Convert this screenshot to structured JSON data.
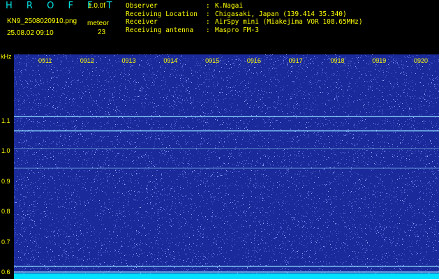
{
  "header": {
    "app_title": "H R O F F T",
    "version": "1.0.0f",
    "file_name": "KN9_2508020910.png",
    "file_datetime": "25.08.02 09:10",
    "meteor_label": "meteor",
    "meteor_count": "23",
    "info": [
      {
        "key": "Observer",
        "sep": ":",
        "value": "K.Nagai"
      },
      {
        "key": "Receiving Location",
        "sep": ":",
        "value": "Chigasaki, Japan (139.414 35.340)"
      },
      {
        "key": "Receiver",
        "sep": ":",
        "value": "AirSpy mini (Miakejima VOR 108.65MHz)"
      },
      {
        "key": "Receiving antenna",
        "sep": ":",
        "value": "Maspro FM-3"
      }
    ]
  },
  "chart_data": {
    "type": "heatmap",
    "ylabel": "kHz",
    "ylim": [
      0.58,
      1.32
    ],
    "yticks": [
      "1.1",
      "1.0",
      "0.9",
      "0.8",
      "0.7",
      "0.6"
    ],
    "xticks": [
      "0911",
      "0912",
      "0913",
      "0914",
      "0915",
      "0916",
      "0917",
      "0918",
      "0919",
      "0920"
    ],
    "horizontal_lines_khz": [
      1.115,
      1.068,
      1.01,
      0.945,
      0.622,
      0.603
    ],
    "colors": {
      "background": "#1a2a9a",
      "noise": "#8ea6ff",
      "line": "#8fd8ff",
      "bottom_band": "#00e0ff",
      "text": "#ffff00"
    }
  }
}
